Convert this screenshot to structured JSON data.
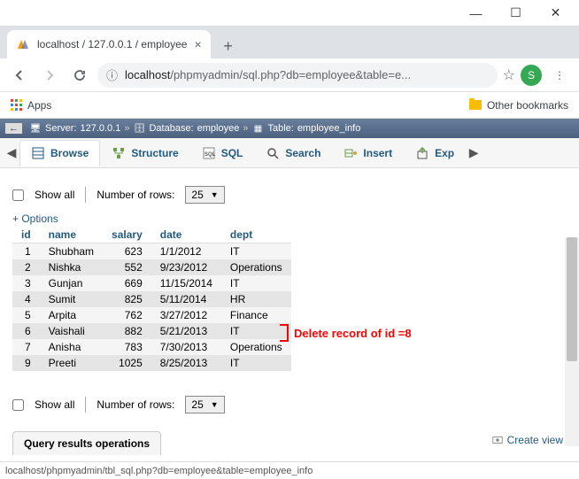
{
  "browser": {
    "tab_title": "localhost / 127.0.0.1 / employee",
    "url_prefix": "localhost",
    "url_path": "/phpmyadmin/sql.php?db=employee&table=e...",
    "apps": "Apps",
    "other_bookmarks": "Other bookmarks",
    "avatar_letter": "S"
  },
  "breadcrumb": {
    "server_label": "Server:",
    "server_value": "127.0.0.1",
    "db_label": "Database:",
    "db_value": "employee",
    "table_label": "Table:",
    "table_value": "employee_info"
  },
  "tabs": {
    "browse": "Browse",
    "structure": "Structure",
    "sql": "SQL",
    "search": "Search",
    "insert": "Insert",
    "export": "Exp"
  },
  "controls": {
    "show_all": "Show all",
    "num_rows_label": "Number of rows:",
    "num_rows_value": "25",
    "options": "+ Options"
  },
  "table": {
    "headers": {
      "id": "id",
      "name": "name",
      "salary": "salary",
      "date": "date",
      "dept": "dept"
    },
    "rows": [
      {
        "id": "1",
        "name": "Shubham",
        "salary": "623",
        "date": "1/1/2012",
        "dept": "IT"
      },
      {
        "id": "2",
        "name": "Nishka",
        "salary": "552",
        "date": "9/23/2012",
        "dept": "Operations"
      },
      {
        "id": "3",
        "name": "Gunjan",
        "salary": "669",
        "date": "11/15/2014",
        "dept": "IT"
      },
      {
        "id": "4",
        "name": "Sumit",
        "salary": "825",
        "date": "5/11/2014",
        "dept": "HR"
      },
      {
        "id": "5",
        "name": "Arpita",
        "salary": "762",
        "date": "3/27/2012",
        "dept": "Finance"
      },
      {
        "id": "6",
        "name": "Vaishali",
        "salary": "882",
        "date": "5/21/2013",
        "dept": "IT"
      },
      {
        "id": "7",
        "name": "Anisha",
        "salary": "783",
        "date": "7/30/2013",
        "dept": "Operations"
      },
      {
        "id": "9",
        "name": "Preeti",
        "salary": "1025",
        "date": "8/25/2013",
        "dept": "IT"
      }
    ]
  },
  "annotation": "Delete record of id =8",
  "query_ops": "Query results operations",
  "create_view": "Create view",
  "status_url": "localhost/phpmyadmin/tbl_sql.php?db=employee&table=employee_info",
  "chart_data": {
    "type": "table",
    "columns": [
      "id",
      "name",
      "salary",
      "date",
      "dept"
    ],
    "rows": [
      [
        1,
        "Shubham",
        623,
        "1/1/2012",
        "IT"
      ],
      [
        2,
        "Nishka",
        552,
        "9/23/2012",
        "Operations"
      ],
      [
        3,
        "Gunjan",
        669,
        "11/15/2014",
        "IT"
      ],
      [
        4,
        "Sumit",
        825,
        "5/11/2014",
        "HR"
      ],
      [
        5,
        "Arpita",
        762,
        "3/27/2012",
        "Finance"
      ],
      [
        6,
        "Vaishali",
        882,
        "5/21/2013",
        "IT"
      ],
      [
        7,
        "Anisha",
        783,
        "7/30/2013",
        "Operations"
      ],
      [
        9,
        "Preeti",
        1025,
        "8/25/2013",
        "IT"
      ]
    ]
  }
}
